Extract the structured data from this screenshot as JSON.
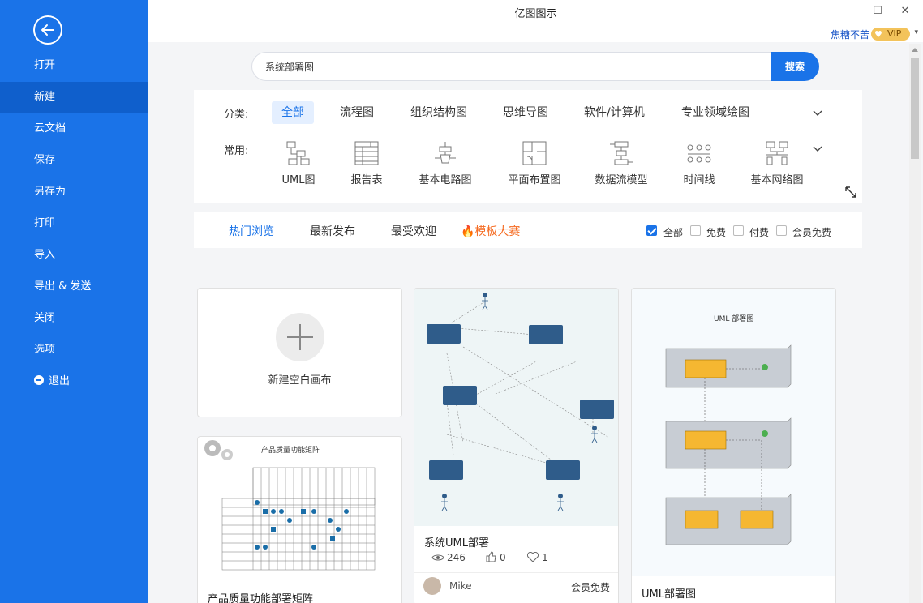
{
  "window": {
    "title": "亿图图示",
    "minimize": "–",
    "maximize": "☐",
    "close": "✕"
  },
  "user": {
    "name": "焦糖不苦",
    "vip": "VIP"
  },
  "sidebar": {
    "items": [
      {
        "label": "打开"
      },
      {
        "label": "新建"
      },
      {
        "label": "云文档"
      },
      {
        "label": "保存"
      },
      {
        "label": "另存为"
      },
      {
        "label": "打印"
      },
      {
        "label": "导入"
      },
      {
        "label": "导出 & 发送"
      },
      {
        "label": "关闭"
      },
      {
        "label": "选项"
      },
      {
        "label": "退出"
      }
    ],
    "active": "新建"
  },
  "search": {
    "value": "系统部署图",
    "button": "搜索"
  },
  "filters": {
    "category_label": "分类:",
    "categories": [
      "全部",
      "流程图",
      "组织结构图",
      "思维导图",
      "软件/计算机",
      "专业领域绘图"
    ],
    "common_label": "常用:",
    "common": [
      "UML图",
      "报告表",
      "基本电路图",
      "平面布置图",
      "数据流模型",
      "时间线",
      "基本网络图"
    ]
  },
  "tabs": {
    "items": [
      "热门浏览",
      "最新发布",
      "最受欢迎",
      "模板大赛"
    ],
    "checks": [
      {
        "label": "全部",
        "checked": true
      },
      {
        "label": "免费",
        "checked": false
      },
      {
        "label": "付费",
        "checked": false
      },
      {
        "label": "会员免费",
        "checked": false
      }
    ]
  },
  "cards": {
    "new_blank": "新建空白画布",
    "matrix": {
      "title": "产品质量功能部署矩阵",
      "thumb_title": "产品质量功能矩阵"
    },
    "uml1": {
      "title": "系统UML部署",
      "views": "246",
      "likes": "0",
      "favs": "1",
      "author": "Mike",
      "price": "会员免费"
    },
    "uml2": {
      "title": "UML部署图",
      "thumb_title": "UML 部署图"
    }
  },
  "colors": {
    "accent": "#1a73e8",
    "hot": "#f56a20",
    "uml_node": "#2f5c8a",
    "uml2_node": "#f5b731"
  }
}
